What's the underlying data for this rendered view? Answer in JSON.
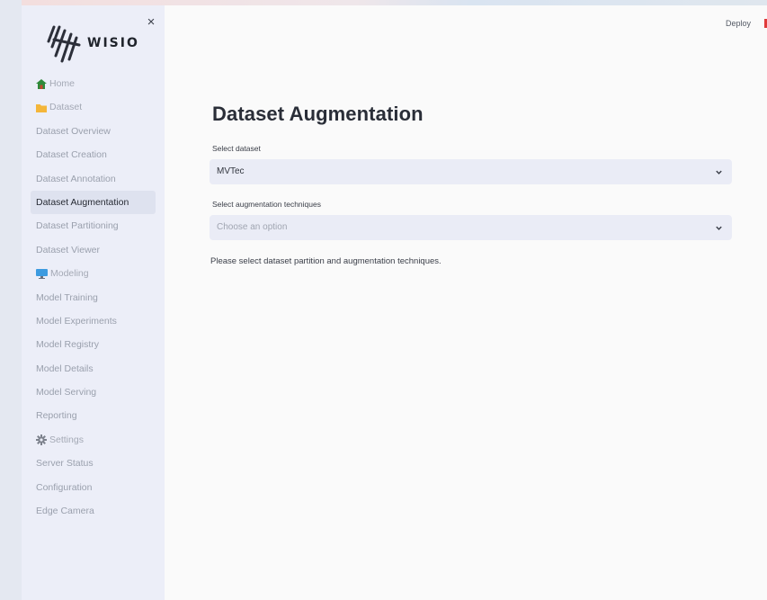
{
  "app": {
    "brand": "WISIO",
    "deploy_label": "Deploy"
  },
  "sidebar": {
    "items": [
      {
        "label": "Home",
        "type": "section",
        "icon": "home-icon"
      },
      {
        "label": "Dataset",
        "type": "section",
        "icon": "folder-icon"
      },
      {
        "label": "Dataset Overview",
        "type": "page"
      },
      {
        "label": "Dataset Creation",
        "type": "page"
      },
      {
        "label": "Dataset Annotation",
        "type": "page"
      },
      {
        "label": "Dataset Augmentation",
        "type": "page",
        "active": true
      },
      {
        "label": "Dataset Partitioning",
        "type": "page"
      },
      {
        "label": "Dataset Viewer",
        "type": "page"
      },
      {
        "label": "Modeling",
        "type": "section",
        "icon": "monitor-icon"
      },
      {
        "label": "Model Training",
        "type": "page"
      },
      {
        "label": "Model Experiments",
        "type": "page"
      },
      {
        "label": "Model Registry",
        "type": "page"
      },
      {
        "label": "Model Details",
        "type": "page"
      },
      {
        "label": "Model Serving",
        "type": "page"
      },
      {
        "label": "Reporting",
        "type": "page"
      },
      {
        "label": "Settings",
        "type": "section",
        "icon": "gear-icon"
      },
      {
        "label": "Server Status",
        "type": "page"
      },
      {
        "label": "Configuration",
        "type": "page"
      },
      {
        "label": "Edge Camera",
        "type": "page"
      }
    ]
  },
  "main": {
    "title": "Dataset Augmentation",
    "dataset_select": {
      "label": "Select dataset",
      "value": "MVTec"
    },
    "augmentation_select": {
      "label": "Select augmentation techniques",
      "placeholder": "Choose an option"
    },
    "info": "Please select dataset partition and augmentation techniques."
  },
  "colors": {
    "sidebar_bg": "#eceef8",
    "main_bg": "#fafafa",
    "select_bg": "#eaecf6",
    "active_item_bg": "#dee2ef",
    "home_icon": "#2f8a3a",
    "folder_icon": "#f4b63a",
    "monitor_icon": "#3d9be0",
    "deploy_mark": "#e03a3a"
  }
}
